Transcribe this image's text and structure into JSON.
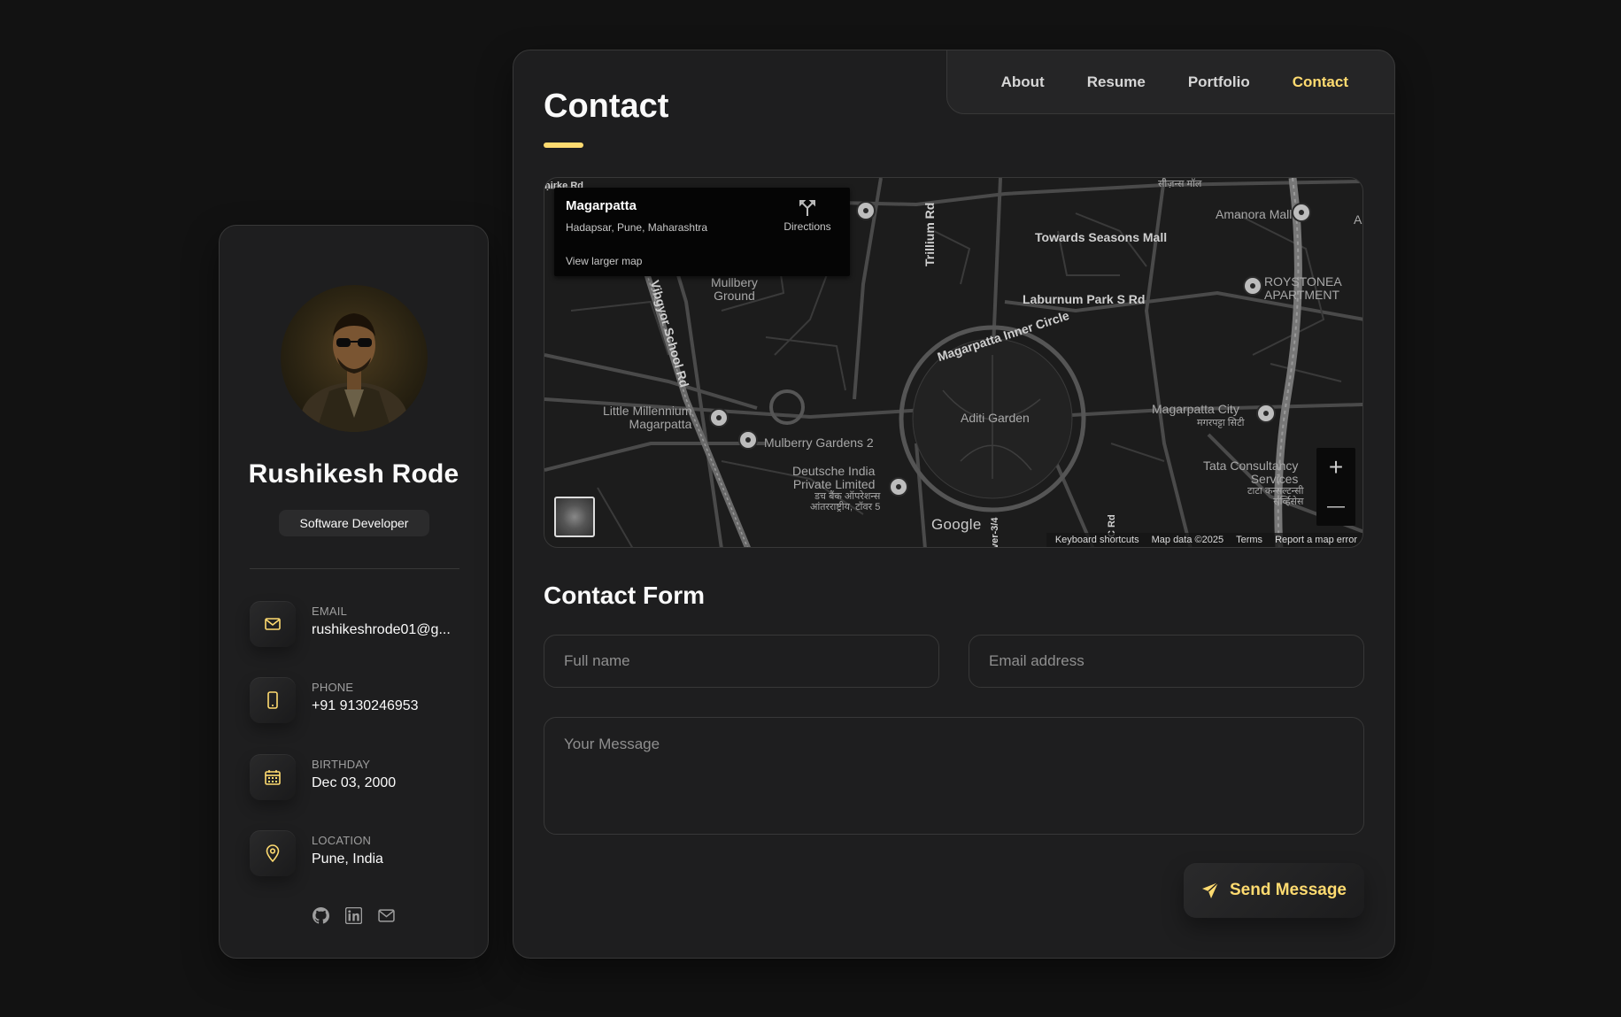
{
  "sidebar": {
    "name": "Rushikesh Rode",
    "title": "Software Developer",
    "contacts": [
      {
        "label": "EMAIL",
        "value": "rushikeshrode01@g...",
        "icon": "mail-icon"
      },
      {
        "label": "PHONE",
        "value": "+91 9130246953",
        "icon": "phone-icon"
      },
      {
        "label": "BIRTHDAY",
        "value": "Dec 03, 2000",
        "icon": "calendar-icon"
      },
      {
        "label": "LOCATION",
        "value": "Pune, India",
        "icon": "location-pin-icon"
      }
    ],
    "socials": [
      "github-icon",
      "linkedin-icon",
      "mail-icon"
    ]
  },
  "nav": {
    "items": [
      "About",
      "Resume",
      "Portfolio",
      "Contact"
    ],
    "active": "Contact"
  },
  "page": {
    "title": "Contact"
  },
  "map": {
    "place_name": "Magarpatta",
    "place_address": "Hadapsar, Pune, Maharashtra",
    "directions_label": "Directions",
    "larger_map_label": "View larger map",
    "labels": {
      "mall_hi": "सीज़न्स मॉल",
      "amanora": "Amanora Mall",
      "towards": "Towards Seasons Mall",
      "trillium": "Trillium Rd",
      "laburnum": "Laburnum Park S Rd",
      "roystonea": "ROYSTONEA\nAPARTMENT",
      "mullbery": "Mullbery\nGround",
      "vibgyor": "Vibgyor School Rd",
      "inner_circle": "Magarpatta Inner Circle",
      "aditi": "Aditi Garden",
      "magarpatta_city": "Magarpatta City",
      "magarpatta_city_hi": "मगरपट्टा सिटी",
      "little_millennium": "Little Millennium\nMagarpatta",
      "mulberry": "Mulberry Gardens 2",
      "deutsche": "Deutsche India\nPrivate Limited",
      "deutsche_hi": "डच बैंक ऑपरेशन्स\nआंतरराष्ट्रीय, टॉवर 5",
      "tcs": "Tata Consultancy\nServices",
      "tcs_hi": "टाटा कन्सल्टन्सी\nसर्व्हिसेस",
      "birke": "ṇirke Rd",
      "c_rd": "C Rd",
      "ver": "ver-3/4",
      "a_edge": "A"
    },
    "google": "Google",
    "footer": [
      "Keyboard shortcuts",
      "Map data ©2025",
      "Terms",
      "Report a map error"
    ],
    "zoom_in": "+",
    "zoom_out": "—"
  },
  "form": {
    "title": "Contact Form",
    "fullname_placeholder": "Full name",
    "email_placeholder": "Email address",
    "message_placeholder": "Your Message",
    "submit_label": "Send Message"
  },
  "colors": {
    "accent": "#ffdb70",
    "background": "#121212",
    "panel": "#1e1e1f",
    "border": "#383838"
  }
}
